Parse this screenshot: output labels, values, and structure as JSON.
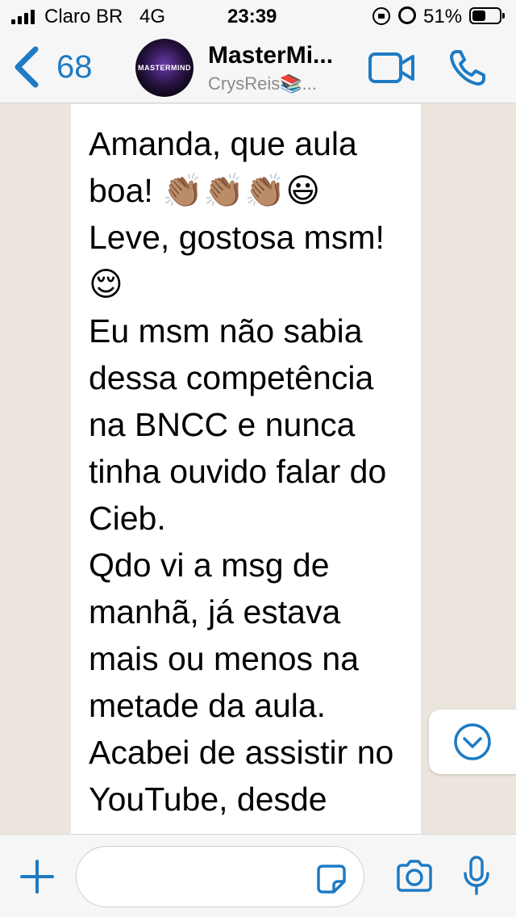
{
  "status_bar": {
    "carrier": "Claro BR",
    "network": "4G",
    "time": "23:39",
    "battery_percent": "51%",
    "battery_level": 0.51
  },
  "header": {
    "back_count": "68",
    "avatar_text": "MASTERMIND",
    "title": "MasterMi...",
    "subtitle": "CrysReis📚...",
    "accent_color": "#1e7bc4"
  },
  "chat": {
    "message_text": "Amanda, que aula boa! 👏🏽👏🏽👏🏽😃\nLeve, gostosa msm! 😌\nEu msm não sabia dessa competência na BNCC e nunca tinha ouvido falar do Cieb.\nQdo vi a msg de manhã, já estava mais ou menos na metade da aula.\nAcabei de assistir no YouTube, desde"
  },
  "input_bar": {
    "placeholder": ""
  },
  "icons": {
    "back": "chevron-left-icon",
    "video": "video-camera-icon",
    "phone": "phone-icon",
    "scroll_down": "chevron-down-circle-icon",
    "plus": "plus-icon",
    "sticker": "sticker-icon",
    "camera": "camera-icon",
    "mic": "microphone-icon"
  }
}
